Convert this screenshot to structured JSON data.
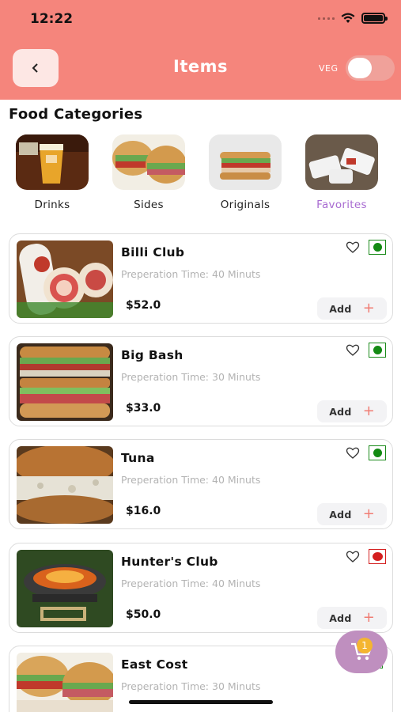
{
  "status_bar": {
    "time": "12:22"
  },
  "header": {
    "title": "Items",
    "veg_label": "VEG",
    "back_icon": "chevron-left-icon"
  },
  "categories": {
    "title": "Food Categories",
    "items": [
      {
        "label": "Drinks",
        "active": false
      },
      {
        "label": "Sides",
        "active": false
      },
      {
        "label": "Originals",
        "active": false
      },
      {
        "label": "Favorites",
        "active": true
      }
    ]
  },
  "items": [
    {
      "name": "Billi Club",
      "prep": "Preperation Time: 40 Minuts",
      "price": "$52.0",
      "add_label": "Add",
      "veg": true
    },
    {
      "name": "Big Bash",
      "prep": "Preperation Time: 30 Minuts",
      "price": "$33.0",
      "add_label": "Add",
      "veg": true
    },
    {
      "name": "Tuna",
      "prep": "Preperation Time: 40 Minuts",
      "price": "$16.0",
      "add_label": "Add",
      "veg": true
    },
    {
      "name": "Hunter's Club",
      "prep": "Preperation Time: 40 Minuts",
      "price": "$50.0",
      "add_label": "Add",
      "veg": false
    },
    {
      "name": "East Cost",
      "prep": "Preperation Time: 30 Minuts",
      "price": "",
      "add_label": "",
      "veg": true
    }
  ],
  "cart": {
    "count": "1",
    "icon": "cart-icon"
  },
  "colors": {
    "header": "#f5857c",
    "accent": "#f07c73",
    "favorites": "#a86bd1",
    "veg": "#138a13",
    "nonveg": "#d42020"
  }
}
